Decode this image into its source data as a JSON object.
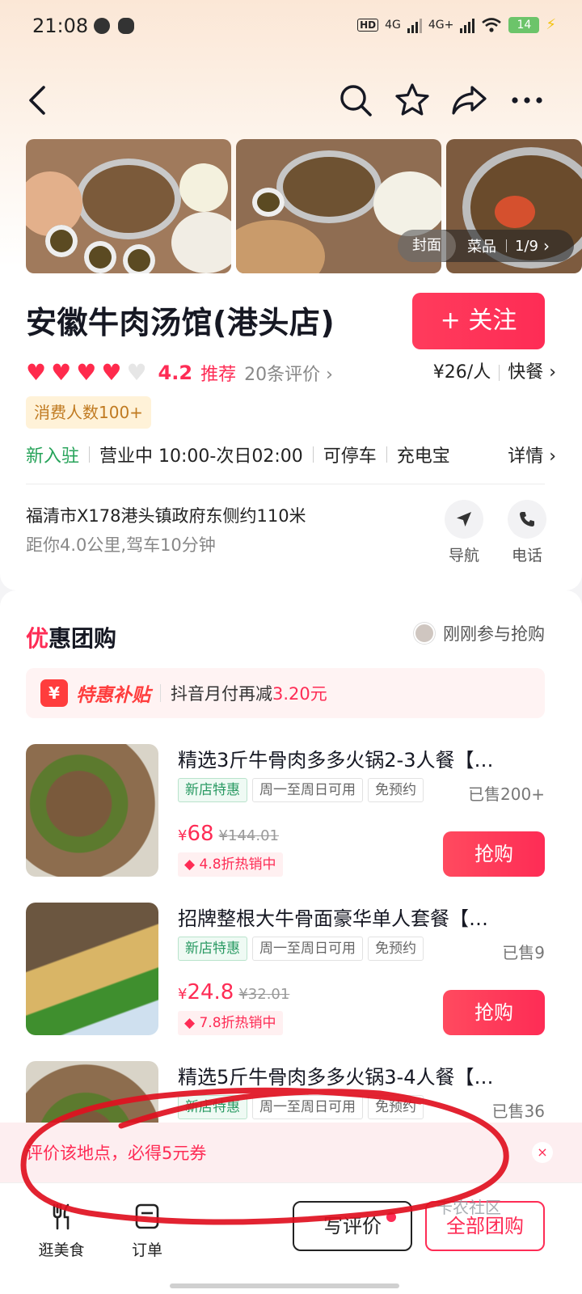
{
  "status_bar": {
    "time": "21:08",
    "network_1": "4G",
    "network_2": "4G+",
    "battery": "14"
  },
  "nav": {
    "back_icon": "chevron-left-icon",
    "icons": [
      "search-icon",
      "star-icon",
      "share-icon",
      "more-icon"
    ]
  },
  "gallery": {
    "cover_label": "封面",
    "dish_label": "菜品",
    "counter": "1/9",
    "arrow": "›"
  },
  "store": {
    "name": "安徽牛肉汤馆(港头店)",
    "follow_label": "+ 关注",
    "rating_value": 4.2,
    "rating_max": 5,
    "score": "4.2",
    "recommend": "推荐",
    "reviews": "20条评价 ›",
    "price_per_person": "¥26/人",
    "category": "快餐 ›",
    "consumer_tag": "消费人数100+",
    "new_tag": "新入驻",
    "hours": "营业中 10:00-次日02:00",
    "parking": "可停车",
    "powerbank": "充电宝",
    "details": "详情 ›",
    "address": "福清市X178港头镇政府东侧约110米",
    "distance": "距你4.0公里,驾车10分钟",
    "navigate_label": "导航",
    "phone_label": "电话"
  },
  "deals_section": {
    "title_first": "优",
    "title_rest": "惠团购",
    "recent_text": "刚刚参与抢购",
    "subsidy_badge": "¥",
    "subsidy_title": "特惠补贴",
    "subsidy_text": "抖音月付再减",
    "subsidy_amount": "3.20元",
    "items": [
      {
        "title": "精选3斤牛骨肉多多火锅2-3人餐【…",
        "tag1": "新店特惠",
        "tag2": "周一至周日可用",
        "tag3": "免预约",
        "sold": "已售200+",
        "currency": "¥",
        "price": "68",
        "original_price": "¥144.01",
        "discount": "4.8折热销中",
        "buy_label": "抢购"
      },
      {
        "title": "招牌整根大牛骨面豪华单人套餐【…",
        "tag1": "新店特惠",
        "tag2": "周一至周日可用",
        "tag3": "免预约",
        "sold": "已售9",
        "currency": "¥",
        "price": "24.8",
        "original_price": "¥32.01",
        "discount": "7.8折热销中",
        "buy_label": "抢购"
      },
      {
        "title": "精选5斤牛骨肉多多火锅3-4人餐【…",
        "tag1": "新店特惠",
        "tag2": "周一至周日可用",
        "tag3": "免预约",
        "sold": "已售36"
      }
    ]
  },
  "review_banner": {
    "text": "评价该地点，必得5元券",
    "close": "×"
  },
  "bottom_bar": {
    "explore_label": "逛美食",
    "orders_label": "订单",
    "write_review_label": "写评价",
    "all_deals_label": "全部团购",
    "watermark": "卡农社区"
  },
  "colors": {
    "accent": "#fe2c55",
    "green": "#27a35a",
    "gold": "#c07a20"
  }
}
